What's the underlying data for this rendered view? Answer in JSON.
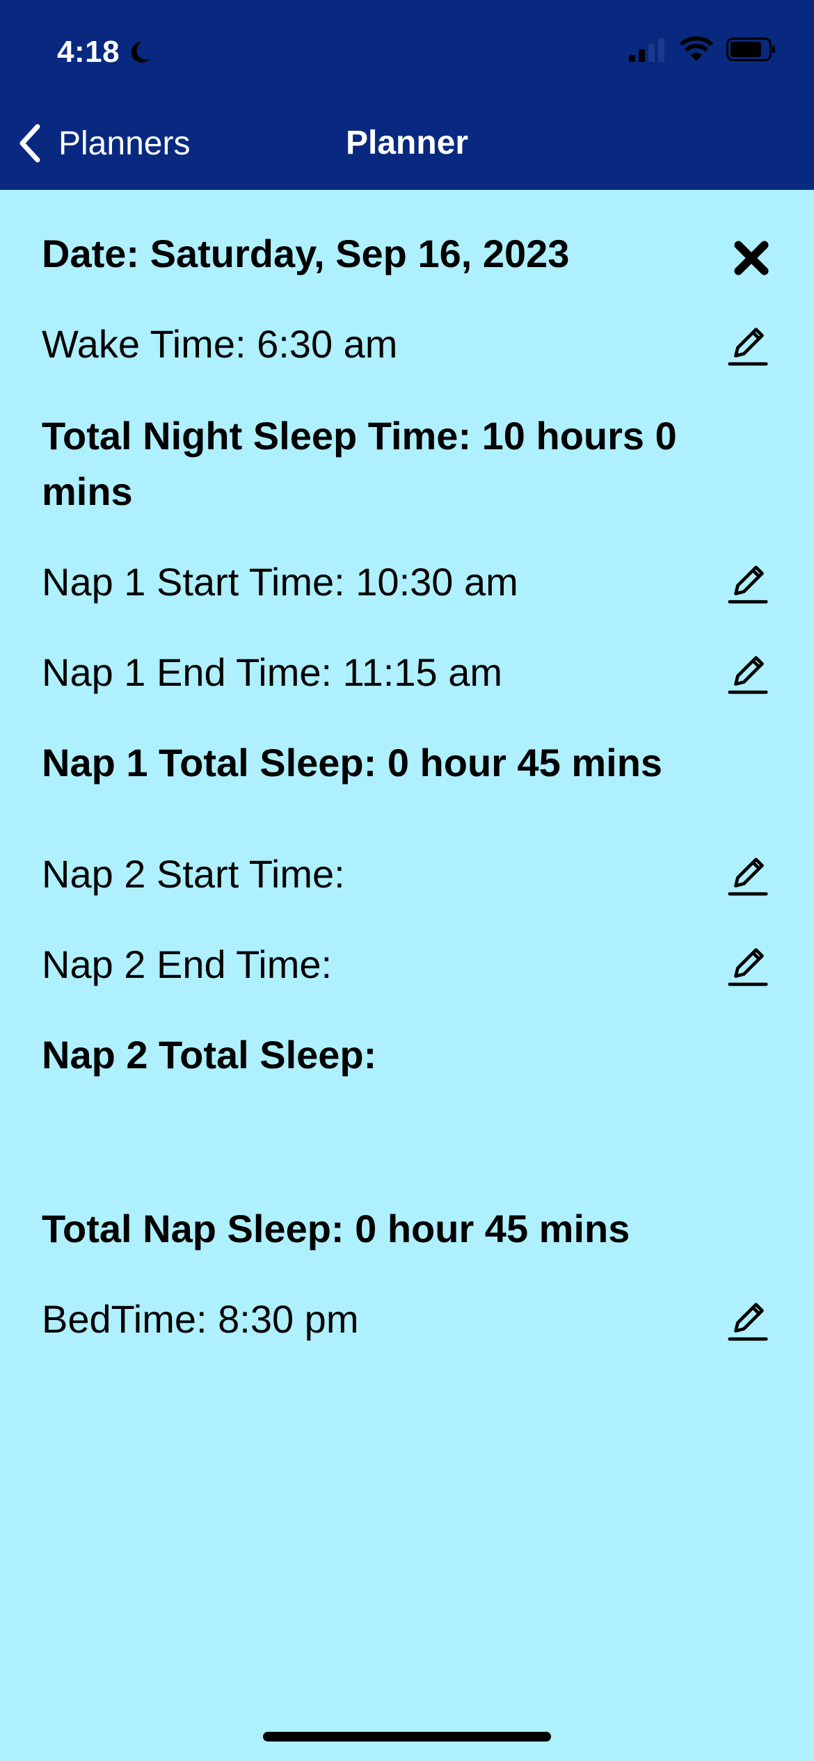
{
  "status_bar": {
    "time": "4:18"
  },
  "nav": {
    "back_label": "Planners",
    "title": "Planner"
  },
  "planner": {
    "date": "Date: Saturday, Sep 16, 2023",
    "wake_time": "Wake Time: 6:30 am",
    "total_night_sleep": "Total Night Sleep Time: 10 hours 0 mins",
    "nap1_start": "Nap 1 Start Time: 10:30 am",
    "nap1_end": "Nap 1 End Time: 11:15 am",
    "nap1_total": "Nap 1 Total Sleep: 0 hour 45 mins",
    "nap2_start": "Nap 2 Start Time:",
    "nap2_end": "Nap 2 End Time:",
    "nap2_total": "Nap 2 Total Sleep:",
    "total_nap_sleep": "Total Nap Sleep: 0 hour 45 mins",
    "bedtime": "BedTime: 8:30 pm"
  },
  "colors": {
    "header": "#08297f",
    "background": "#aef0fe",
    "text": "#000000"
  }
}
